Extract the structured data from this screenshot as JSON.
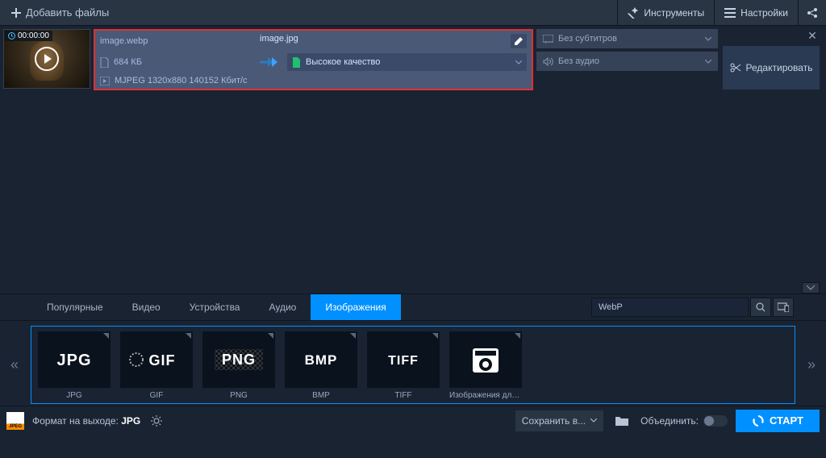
{
  "topbar": {
    "add_files": "Добавить файлы",
    "tools": "Инструменты",
    "settings": "Настройки"
  },
  "file": {
    "duration": "00:00:00",
    "input_name": "image.webp",
    "output_name": "image.jpg",
    "size": "684 КБ",
    "codec": "MJPEG 1320x880 140152 Кбит/с",
    "quality_selected": "Высокое качество",
    "subtitle_selected": "Без субтитров",
    "audio_selected": "Без аудио",
    "edit_btn": "Редактировать"
  },
  "tabs": {
    "popular": "Популярные",
    "video": "Видео",
    "devices": "Устройства",
    "audio": "Аудио",
    "images": "Изображения"
  },
  "search": {
    "value": "WebP"
  },
  "tiles": [
    {
      "name": "JPG",
      "label": "JPG"
    },
    {
      "name": "GIF",
      "label": "GIF"
    },
    {
      "name": "PNG",
      "label": "PNG"
    },
    {
      "name": "BMP",
      "label": "BMP"
    },
    {
      "name": "TIFF",
      "label": "TIFF"
    },
    {
      "name": "",
      "label": "Изображения для с..."
    }
  ],
  "bottom": {
    "format_label": "Формат на выходе:",
    "format_value": "JPG",
    "save_to": "Сохранить в...",
    "merge": "Объединить:",
    "start": "СТАРТ"
  }
}
